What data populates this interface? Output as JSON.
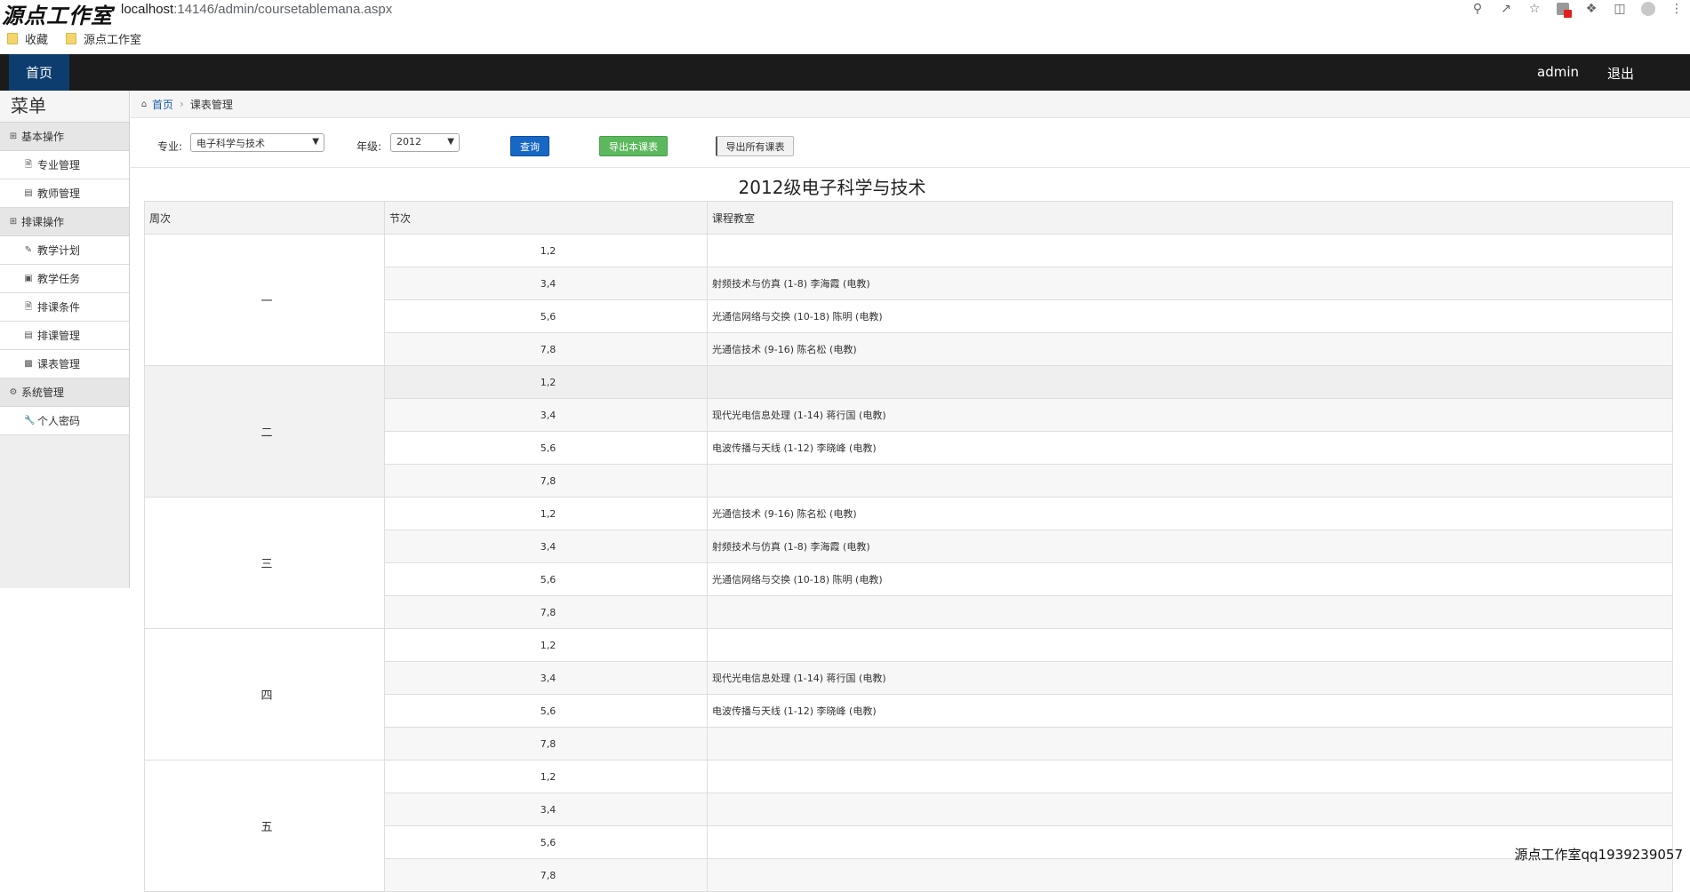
{
  "browser": {
    "watermark": "源点工作室",
    "url_host": "localhost",
    "url_rest": ":14146/admin/coursetablemana.aspx",
    "bookmarks": [
      "收藏",
      "源点工作室"
    ]
  },
  "nav": {
    "home": "首页",
    "user": "admin",
    "logout": "退出"
  },
  "sidebar": {
    "title": "菜单",
    "groups": [
      {
        "label": "基本操作",
        "icon": "plus-square-icon",
        "items": [
          {
            "label": "专业管理",
            "icon": "file-icon"
          },
          {
            "label": "教师管理",
            "icon": "list-icon"
          }
        ]
      },
      {
        "label": "排课操作",
        "icon": "plus-square-icon",
        "items": [
          {
            "label": "教学计划",
            "icon": "pencil-icon"
          },
          {
            "label": "教学任务",
            "icon": "picture-icon"
          },
          {
            "label": "排课条件",
            "icon": "file-icon"
          },
          {
            "label": "排课管理",
            "icon": "list-icon"
          },
          {
            "label": "课表管理",
            "icon": "table-icon"
          }
        ]
      },
      {
        "label": "系统管理",
        "icon": "gear-icon",
        "items": [
          {
            "label": "个人密码",
            "icon": "wrench-icon"
          }
        ]
      }
    ]
  },
  "breadcrumb": {
    "home": "首页",
    "current": "课表管理"
  },
  "filters": {
    "major_label": "专业:",
    "major_value": "电子科学与技术",
    "grade_label": "年级:",
    "grade_value": "2012",
    "query_button": "查询",
    "export_current_button": "导出本课表",
    "export_all_button": "导出所有课表"
  },
  "table": {
    "title": "2012级电子科学与技术",
    "headers": [
      "周次",
      "节次",
      "课程教室"
    ],
    "weeks": [
      {
        "day": "一",
        "rows": [
          {
            "period": "1,2",
            "course": ""
          },
          {
            "period": "3,4",
            "course": "射频技术与仿真 (1-8) 李海霞 (电教)"
          },
          {
            "period": "5,6",
            "course": "光通信网络与交换 (10-18) 陈明 (电教)"
          },
          {
            "period": "7,8",
            "course": "光通信技术 (9-16) 陈名松 (电教)"
          }
        ]
      },
      {
        "day": "二",
        "rows": [
          {
            "period": "1,2",
            "course": ""
          },
          {
            "period": "3,4",
            "course": "现代光电信息处理 (1-14) 蒋行国 (电教)"
          },
          {
            "period": "5,6",
            "course": "电波传播与天线 (1-12) 李晓峰 (电教)"
          },
          {
            "period": "7,8",
            "course": ""
          }
        ]
      },
      {
        "day": "三",
        "rows": [
          {
            "period": "1,2",
            "course": "光通信技术 (9-16) 陈名松 (电教)"
          },
          {
            "period": "3,4",
            "course": "射频技术与仿真 (1-8) 李海霞 (电教)"
          },
          {
            "period": "5,6",
            "course": "光通信网络与交换 (10-18) 陈明 (电教)"
          },
          {
            "period": "7,8",
            "course": ""
          }
        ]
      },
      {
        "day": "四",
        "rows": [
          {
            "period": "1,2",
            "course": ""
          },
          {
            "period": "3,4",
            "course": "现代光电信息处理 (1-14) 蒋行国 (电教)"
          },
          {
            "period": "5,6",
            "course": "电波传播与天线 (1-12) 李晓峰 (电教)"
          },
          {
            "period": "7,8",
            "course": ""
          }
        ]
      },
      {
        "day": "五",
        "rows": [
          {
            "period": "1,2",
            "course": ""
          },
          {
            "period": "3,4",
            "course": ""
          },
          {
            "period": "5,6",
            "course": ""
          },
          {
            "period": "7,8",
            "course": ""
          }
        ]
      }
    ]
  },
  "footer_watermark": "源点工作室qq1939239057"
}
